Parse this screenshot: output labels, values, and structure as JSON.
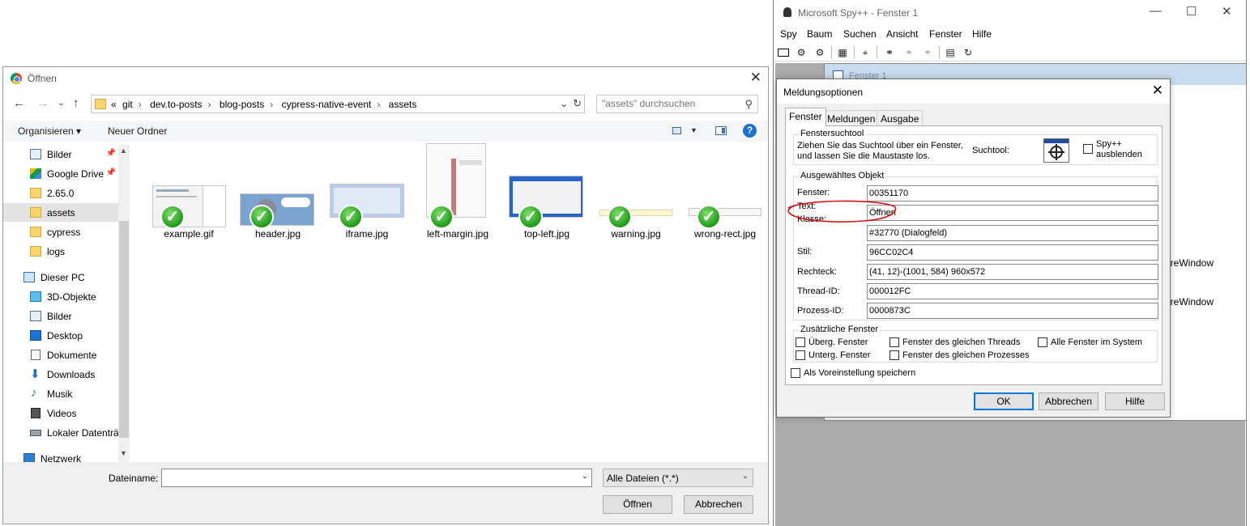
{
  "open_dialog": {
    "title": "Öffnen",
    "breadcrumb": [
      "git",
      "dev.to-posts",
      "blog-posts",
      "cypress-native-event",
      "assets"
    ],
    "breadcrumb_overflow": "«",
    "search_placeholder": "\"assets\" durchsuchen",
    "organize_label": "Organisieren ▾",
    "new_folder_label": "Neuer Ordner",
    "nav_items": [
      {
        "label": "Bilder",
        "icon": "pictures-icon",
        "pinned": true
      },
      {
        "label": "Google Drive",
        "icon": "google-drive-icon",
        "pinned": true
      },
      {
        "label": "2.65.0",
        "icon": "folder-synced-icon"
      },
      {
        "label": "assets",
        "icon": "folder-synced-icon",
        "selected": true
      },
      {
        "label": "cypress",
        "icon": "folder-error-icon"
      },
      {
        "label": "logs",
        "icon": "folder-icon"
      },
      {
        "label": "Dieser PC",
        "icon": "computer-icon"
      },
      {
        "label": "3D-Objekte",
        "icon": "3d-objects-icon"
      },
      {
        "label": "Bilder",
        "icon": "pictures-icon"
      },
      {
        "label": "Desktop",
        "icon": "desktop-icon"
      },
      {
        "label": "Dokumente",
        "icon": "documents-icon"
      },
      {
        "label": "Downloads",
        "icon": "downloads-icon"
      },
      {
        "label": "Musik",
        "icon": "music-icon"
      },
      {
        "label": "Videos",
        "icon": "videos-icon"
      },
      {
        "label": "Lokaler Datenträ",
        "icon": "drive-icon"
      },
      {
        "label": "Netzwerk",
        "icon": "network-icon"
      }
    ],
    "files": [
      {
        "name": "example.gif"
      },
      {
        "name": "header.jpg"
      },
      {
        "name": "iframe.jpg"
      },
      {
        "name": "left-margin.jpg"
      },
      {
        "name": "top-left.jpg"
      },
      {
        "name": "warning.jpg"
      },
      {
        "name": "wrong-rect.jpg"
      }
    ],
    "filename_label": "Dateiname:",
    "filename_value": "",
    "filter_value": "Alle Dateien (*.*)",
    "open_button": "Öffnen",
    "cancel_button": "Abbrechen"
  },
  "spy": {
    "title": "Microsoft Spy++ - Fenster 1",
    "menu": [
      "Spy",
      "Baum",
      "Suchen",
      "Ansicht",
      "Fenster",
      "Hilfe"
    ],
    "mdi_title": "Fenster 1",
    "tree_fragments": [
      "oreWindow",
      "oreWindow"
    ]
  },
  "msg_dialog": {
    "title": "Meldungsoptionen",
    "tabs": [
      "Fenster",
      "Meldungen",
      "Ausgabe"
    ],
    "finder_group": "Fenstersuchtool",
    "finder_text_1": "Ziehen Sie das Suchtool über ein Fenster,",
    "finder_text_2": "und lassen Sie die Maustaste los.",
    "finder_tool_label": "Suchtool:",
    "hide_spy_1": "Spy++",
    "hide_spy_2": "ausblenden",
    "selected_group": "Ausgewähltes Objekt",
    "fields": {
      "fenster_label": "Fenster:",
      "fenster_value": "00351170",
      "text_label": "Text:",
      "text_value": "Öffnen",
      "klasse_label": "Klasse:",
      "klasse_value": "#32770 (Dialogfeld)",
      "stil_label": "Stil:",
      "stil_value": "96CC02C4",
      "rechteck_label": "Rechteck:",
      "rechteck_value": "(41, 12)-(1001, 584) 960x572",
      "thread_label": "Thread-ID:",
      "thread_value": "000012FC",
      "prozess_label": "Prozess-ID:",
      "prozess_value": "0000873C"
    },
    "extra_group": "Zusätzliche Fenster",
    "cb_parent": "Überg. Fenster",
    "cb_child": "Unterg. Fenster",
    "cb_same_thread": "Fenster des gleichen Threads",
    "cb_same_process": "Fenster des gleichen Prozesses",
    "cb_all": "Alle Fenster im System",
    "cb_default": "Als Voreinstellung speichern",
    "ok": "OK",
    "cancel": "Abbrechen",
    "help": "Hilfe"
  },
  "colors": {
    "annotation": "#d41616",
    "selection": "#e3e3e3",
    "accent": "#0078d7"
  }
}
